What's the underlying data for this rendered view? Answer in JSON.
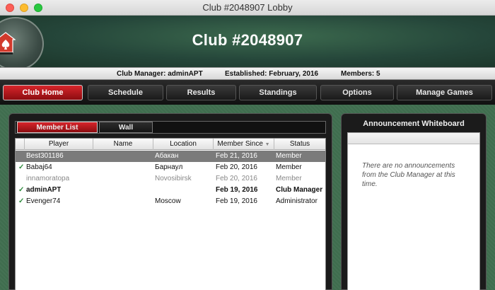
{
  "window": {
    "title": "Club #2048907 Lobby"
  },
  "header": {
    "title": "Club #2048907"
  },
  "info": {
    "manager": "Club Manager: adminAPT",
    "established": "Established: February, 2016",
    "members": "Members: 5"
  },
  "nav": {
    "home": "Club Home",
    "schedule": "Schedule",
    "results": "Results",
    "standings": "Standings",
    "options": "Options",
    "manage": "Manage Games"
  },
  "tabs": {
    "members": "Member List",
    "wall": "Wall"
  },
  "table": {
    "columns": {
      "player": "Player",
      "name": "Name",
      "location": "Location",
      "since": "Member Since",
      "status": "Status"
    },
    "rows": [
      {
        "player": "Best301186",
        "name": "",
        "location": "Абакан",
        "since": "Feb 21, 2016",
        "status": "Member"
      },
      {
        "player": "Babaj64",
        "name": "",
        "location": "Барнаул",
        "since": "Feb 20, 2016",
        "status": "Member"
      },
      {
        "player": "innamoratopa",
        "name": "",
        "location": "Novosibirsk",
        "since": "Feb 20, 2016",
        "status": "Member"
      },
      {
        "player": "adminAPT",
        "name": "",
        "location": "",
        "since": "Feb 19, 2016",
        "status": "Club Manager"
      },
      {
        "player": "Evenger74",
        "name": "",
        "location": "Moscow",
        "since": "Feb 19, 2016",
        "status": "Administrator"
      }
    ]
  },
  "whiteboard": {
    "title": "Announcement Whiteboard",
    "text": "There are no announcements from the Club Manager at this time."
  },
  "colors": {
    "accent_red": "#c4161c",
    "felt_green": "#3f6d4e",
    "check_green": "#2e8b3d"
  },
  "icons": {
    "logo": "spade-house-icon",
    "check": "check-icon",
    "sort": "sort-down-icon"
  }
}
